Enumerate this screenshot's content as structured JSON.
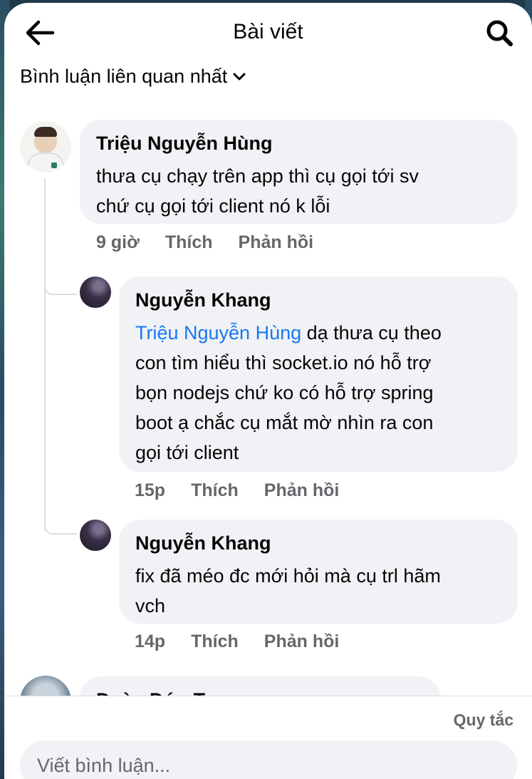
{
  "header": {
    "title": "Bài viết",
    "back_icon": "arrow-left-icon",
    "search_icon": "search-icon"
  },
  "sort": {
    "label": "Bình luận liên quan nhất",
    "icon": "chevron-down-icon"
  },
  "comments": [
    {
      "author": "Triệu Nguyễn Hùng",
      "text": "thưa cụ chạy trên app thì cụ gọi tới sv\nchứ cụ gọi tới client nó k lỗi",
      "time": "9 giờ",
      "like": "Thích",
      "reply": "Phản hồi"
    },
    {
      "author": "Nguyễn Khang",
      "tag": "Triệu Nguyễn Hùng",
      "text": " dạ thưa cụ theo\ncon tìm hiểu thì socket.io nó hỗ trợ\nbọn nodejs chứ ko có hỗ trợ spring\nboot ạ chắc cụ mắt mờ nhìn ra con\ngọi tới client",
      "time": "15p",
      "like": "Thích",
      "reply": "Phản hồi"
    },
    {
      "author": "Nguyễn Khang",
      "text": "fix đã méo đc mới hỏi mà cụ trl hãm\nvch",
      "time": "14p",
      "like": "Thích",
      "reply": "Phản hồi"
    },
    {
      "author": "Đoàn Đức Trung"
    }
  ],
  "footer": {
    "rules_label": "Quy tắc",
    "comment_placeholder": "Viết bình luận..."
  },
  "colors": {
    "bubble": "#f0f2f5",
    "tag": "#1877f2",
    "meta": "#65676b"
  }
}
